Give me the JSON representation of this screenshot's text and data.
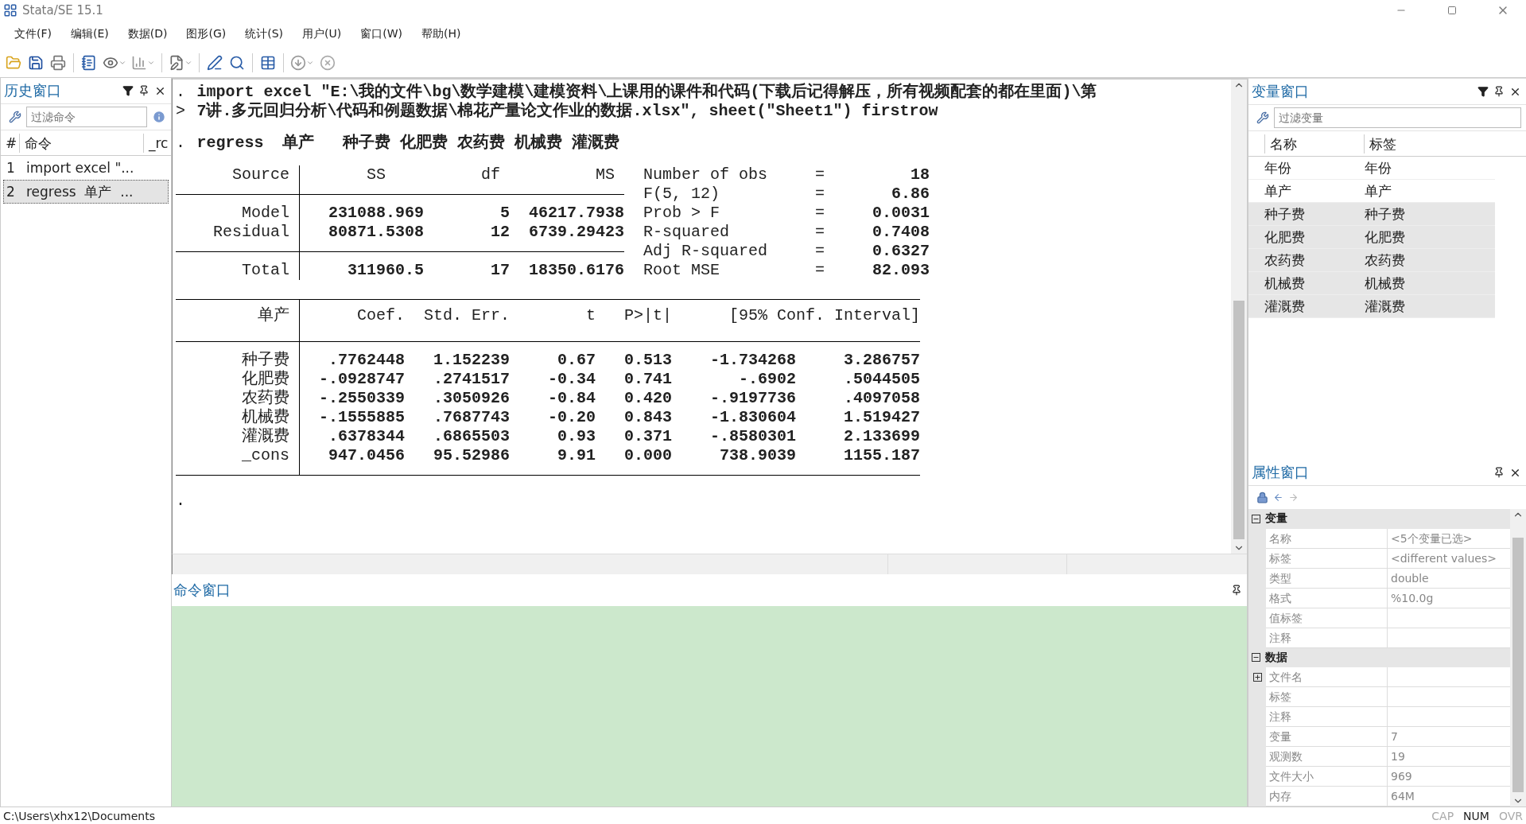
{
  "window": {
    "title": "Stata/SE 15.1"
  },
  "menu": [
    "文件(F)",
    "编辑(E)",
    "数据(D)",
    "图形(G)",
    "统计(S)",
    "用户(U)",
    "窗口(W)",
    "帮助(H)"
  ],
  "history": {
    "title": "历史窗口",
    "filter_placeholder": "过滤命令",
    "columns": [
      "#",
      "命令",
      "_rc"
    ],
    "items": [
      {
        "number": "1",
        "command": "import excel \"...",
        "selected": false
      },
      {
        "number": "2",
        "command": "regress  单产  ...",
        "selected": true
      }
    ]
  },
  "results": {
    "lines": [
      {
        "prompt": ".",
        "text": "import excel \"E:\\我的文件\\bg\\数学建模\\建模资料\\上课用的课件和代码(下载后记得解压，所有视频配套的都在里面)\\第"
      },
      {
        "prompt": ">",
        "text": "7讲.多元回归分析\\代码和例题数据\\棉花产量论文作业的数据.xlsx\", sheet(\"Sheet1\") firstrow"
      },
      {
        "prompt": ".",
        "text": "regress  单产   种子费 化肥费 农药费 机械费 灌溉费"
      }
    ],
    "anova": {
      "columns": [
        "Source",
        "SS",
        "df",
        "MS"
      ],
      "rows": [
        {
          "source": "Model",
          "ss": "231088.969",
          "df": "5",
          "ms": "46217.7938"
        },
        {
          "source": "Residual",
          "ss": "80871.5308",
          "df": "12",
          "ms": "6739.29423"
        },
        {
          "source": "Total",
          "ss": "311960.5",
          "df": "17",
          "ms": "18350.6176"
        }
      ]
    },
    "stats": [
      {
        "label": "Number of obs",
        "sign": "=",
        "value": "18"
      },
      {
        "label": "F(5, 12)",
        "sign": "=",
        "value": "6.86"
      },
      {
        "label": "Prob > F",
        "sign": "=",
        "value": "0.0031"
      },
      {
        "label": "R-squared",
        "sign": "=",
        "value": "0.7408"
      },
      {
        "label": "Adj R-squared",
        "sign": "=",
        "value": "0.6327"
      },
      {
        "label": "Root MSE",
        "sign": "=",
        "value": "82.093"
      }
    ],
    "coef": {
      "depvar": "单产",
      "columns": [
        "Coef.",
        "Std. Err.",
        "t",
        "P>|t|",
        "[95% Conf. Interval]"
      ],
      "rows": [
        {
          "name": "种子费",
          "values": [
            ".7762448",
            "1.152239",
            "0.67",
            "0.513",
            "-1.734268",
            "3.286757"
          ]
        },
        {
          "name": "化肥费",
          "values": [
            "-.0928747",
            ".2741517",
            "-0.34",
            "0.741",
            "-.6902",
            ".5044505"
          ]
        },
        {
          "name": "农药费",
          "values": [
            "-.2550339",
            ".3050926",
            "-0.84",
            "0.420",
            "-.9197736",
            ".4097058"
          ]
        },
        {
          "name": "机械费",
          "values": [
            "-.1555885",
            ".7687743",
            "-0.20",
            "0.843",
            "-1.830604",
            "1.519427"
          ]
        },
        {
          "name": "灌溉费",
          "values": [
            ".6378344",
            ".6865503",
            "0.93",
            "0.371",
            "-.8580301",
            "2.133699"
          ]
        },
        {
          "name": "_cons",
          "values": [
            "947.0456",
            "95.52986",
            "9.91",
            "0.000",
            "738.9039",
            "1155.187"
          ]
        }
      ]
    },
    "trailing_prompt": "."
  },
  "command_window": {
    "title": "命令窗口"
  },
  "variables": {
    "title": "变量窗口",
    "filter_placeholder": "过滤变量",
    "columns": [
      "名称",
      "标签"
    ],
    "rows": [
      {
        "name": "年份",
        "label": "年份",
        "selected": false
      },
      {
        "name": "单产",
        "label": "单产",
        "selected": false
      },
      {
        "name": "种子费",
        "label": "种子费",
        "selected": true
      },
      {
        "name": "化肥费",
        "label": "化肥费",
        "selected": true
      },
      {
        "name": "农药费",
        "label": "农药费",
        "selected": true
      },
      {
        "name": "机械费",
        "label": "机械费",
        "selected": true
      },
      {
        "name": "灌溉费",
        "label": "灌溉费",
        "selected": true
      }
    ]
  },
  "properties": {
    "title": "属性窗口",
    "groups": [
      {
        "name": "变量",
        "expanded": true,
        "rows": [
          {
            "name": "名称",
            "value": "<5个变量已选>"
          },
          {
            "name": "标签",
            "value": "<different values>"
          },
          {
            "name": "类型",
            "value": "double"
          },
          {
            "name": "格式",
            "value": "%10.0g"
          },
          {
            "name": "值标签"
          },
          {
            "name": "注释"
          }
        ]
      },
      {
        "name": "数据",
        "expanded": true,
        "rows": [
          {
            "name": "文件名",
            "expanded": false
          },
          {
            "name": "标签"
          },
          {
            "name": "注释"
          },
          {
            "name": "变量",
            "value": "7"
          },
          {
            "name": "观测数",
            "value": "19"
          },
          {
            "name": "文件大小",
            "value": "969"
          },
          {
            "name": "内存",
            "value": "64M"
          }
        ]
      }
    ]
  },
  "status_bar": {
    "path": "C:\\Users\\xhx12\\Documents",
    "indicators": [
      {
        "label": "CAP",
        "on": false
      },
      {
        "label": "NUM",
        "on": true
      },
      {
        "label": "OVR",
        "on": false
      }
    ]
  }
}
